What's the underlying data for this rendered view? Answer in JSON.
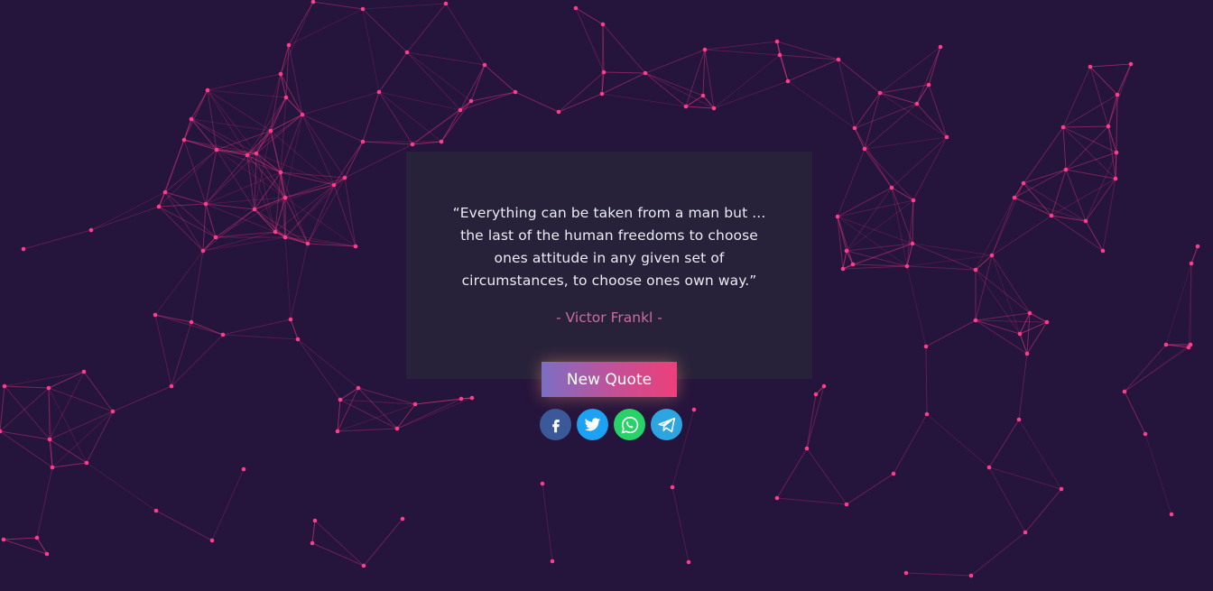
{
  "quote": {
    "text": "“Everything can be taken from a man but ... the last of the human freedoms to choose ones attitude in any given set of circumstances, to choose ones own way.”",
    "author": "- Victor Frankl -"
  },
  "actions": {
    "new_quote_label": "New Quote"
  },
  "share": [
    {
      "icon": "facebook-icon",
      "color": "#3b5998"
    },
    {
      "icon": "twitter-icon",
      "color": "#1da1f2"
    },
    {
      "icon": "whatsapp-icon",
      "color": "#25d366"
    },
    {
      "icon": "telegram-icon",
      "color": "#2ca5e0"
    }
  ],
  "theme": {
    "background": "#25143c",
    "network_color": "#ff3d8b"
  }
}
